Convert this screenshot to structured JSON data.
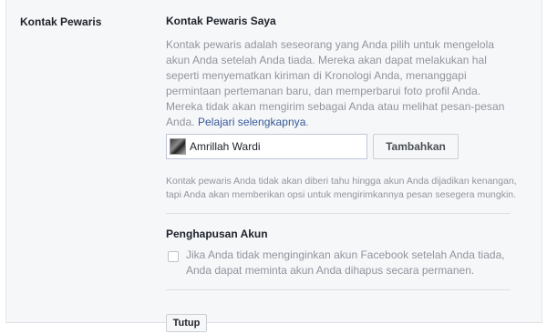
{
  "section": {
    "label": "Kontak Pewaris"
  },
  "legacy_contact": {
    "heading": "Kontak Pewaris Saya",
    "description": "Kontak pewaris adalah seseorang yang Anda pilih untuk mengelola akun Anda setelah Anda tiada. Mereka akan dapat melakukan hal seperti menyematkan kiriman di Kronologi Anda, menanggapi permintaan pertemanan baru, dan memperbarui foto profil Anda. Mereka tidak akan mengirim sebagai Anda atau melihat pesan-pesan Anda.",
    "learn_more": "Pelajari selengkapnya",
    "learn_more_suffix": ".",
    "input_value": "Amrillah Wardi",
    "add_button": "Tambahkan",
    "note": "Kontak pewaris Anda tidak akan diberi tahu hingga akun Anda dijadikan kenangan, tapi Anda akan memberikan opsi untuk mengirimkannya pesan sesegera mungkin."
  },
  "account_deletion": {
    "heading": "Penghapusan Akun",
    "checkbox_label": "Jika Anda tidak menginginkan akun Facebook setelah Anda tiada, Anda dapat meminta akun Anda dihapus secara permanen.",
    "checked": false
  },
  "footer": {
    "close_button": "Tutup"
  }
}
